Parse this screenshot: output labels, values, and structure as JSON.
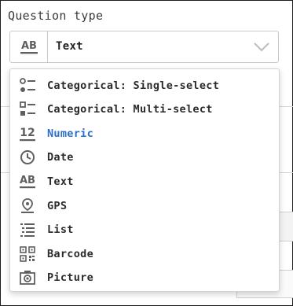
{
  "field": {
    "label": "Question type",
    "selected_value": "Text",
    "selected_icon": "text-type-icon"
  },
  "menu": {
    "items": [
      {
        "label": "Categorical: Single-select",
        "icon": "single-select-icon"
      },
      {
        "label": "Categorical: Multi-select",
        "icon": "multi-select-icon"
      },
      {
        "label": "Numeric",
        "icon": "numeric-icon",
        "highlighted": true
      },
      {
        "label": "Date",
        "icon": "clock-icon"
      },
      {
        "label": "Text",
        "icon": "text-type-icon"
      },
      {
        "label": "GPS",
        "icon": "location-pin-icon"
      },
      {
        "label": "List",
        "icon": "list-icon"
      },
      {
        "label": "Barcode",
        "icon": "qr-code-icon"
      },
      {
        "label": "Picture",
        "icon": "camera-icon"
      }
    ]
  },
  "colors": {
    "icon": "#5f5f5f",
    "highlight": "#2a6fc9",
    "text": "#2b2b2b"
  }
}
